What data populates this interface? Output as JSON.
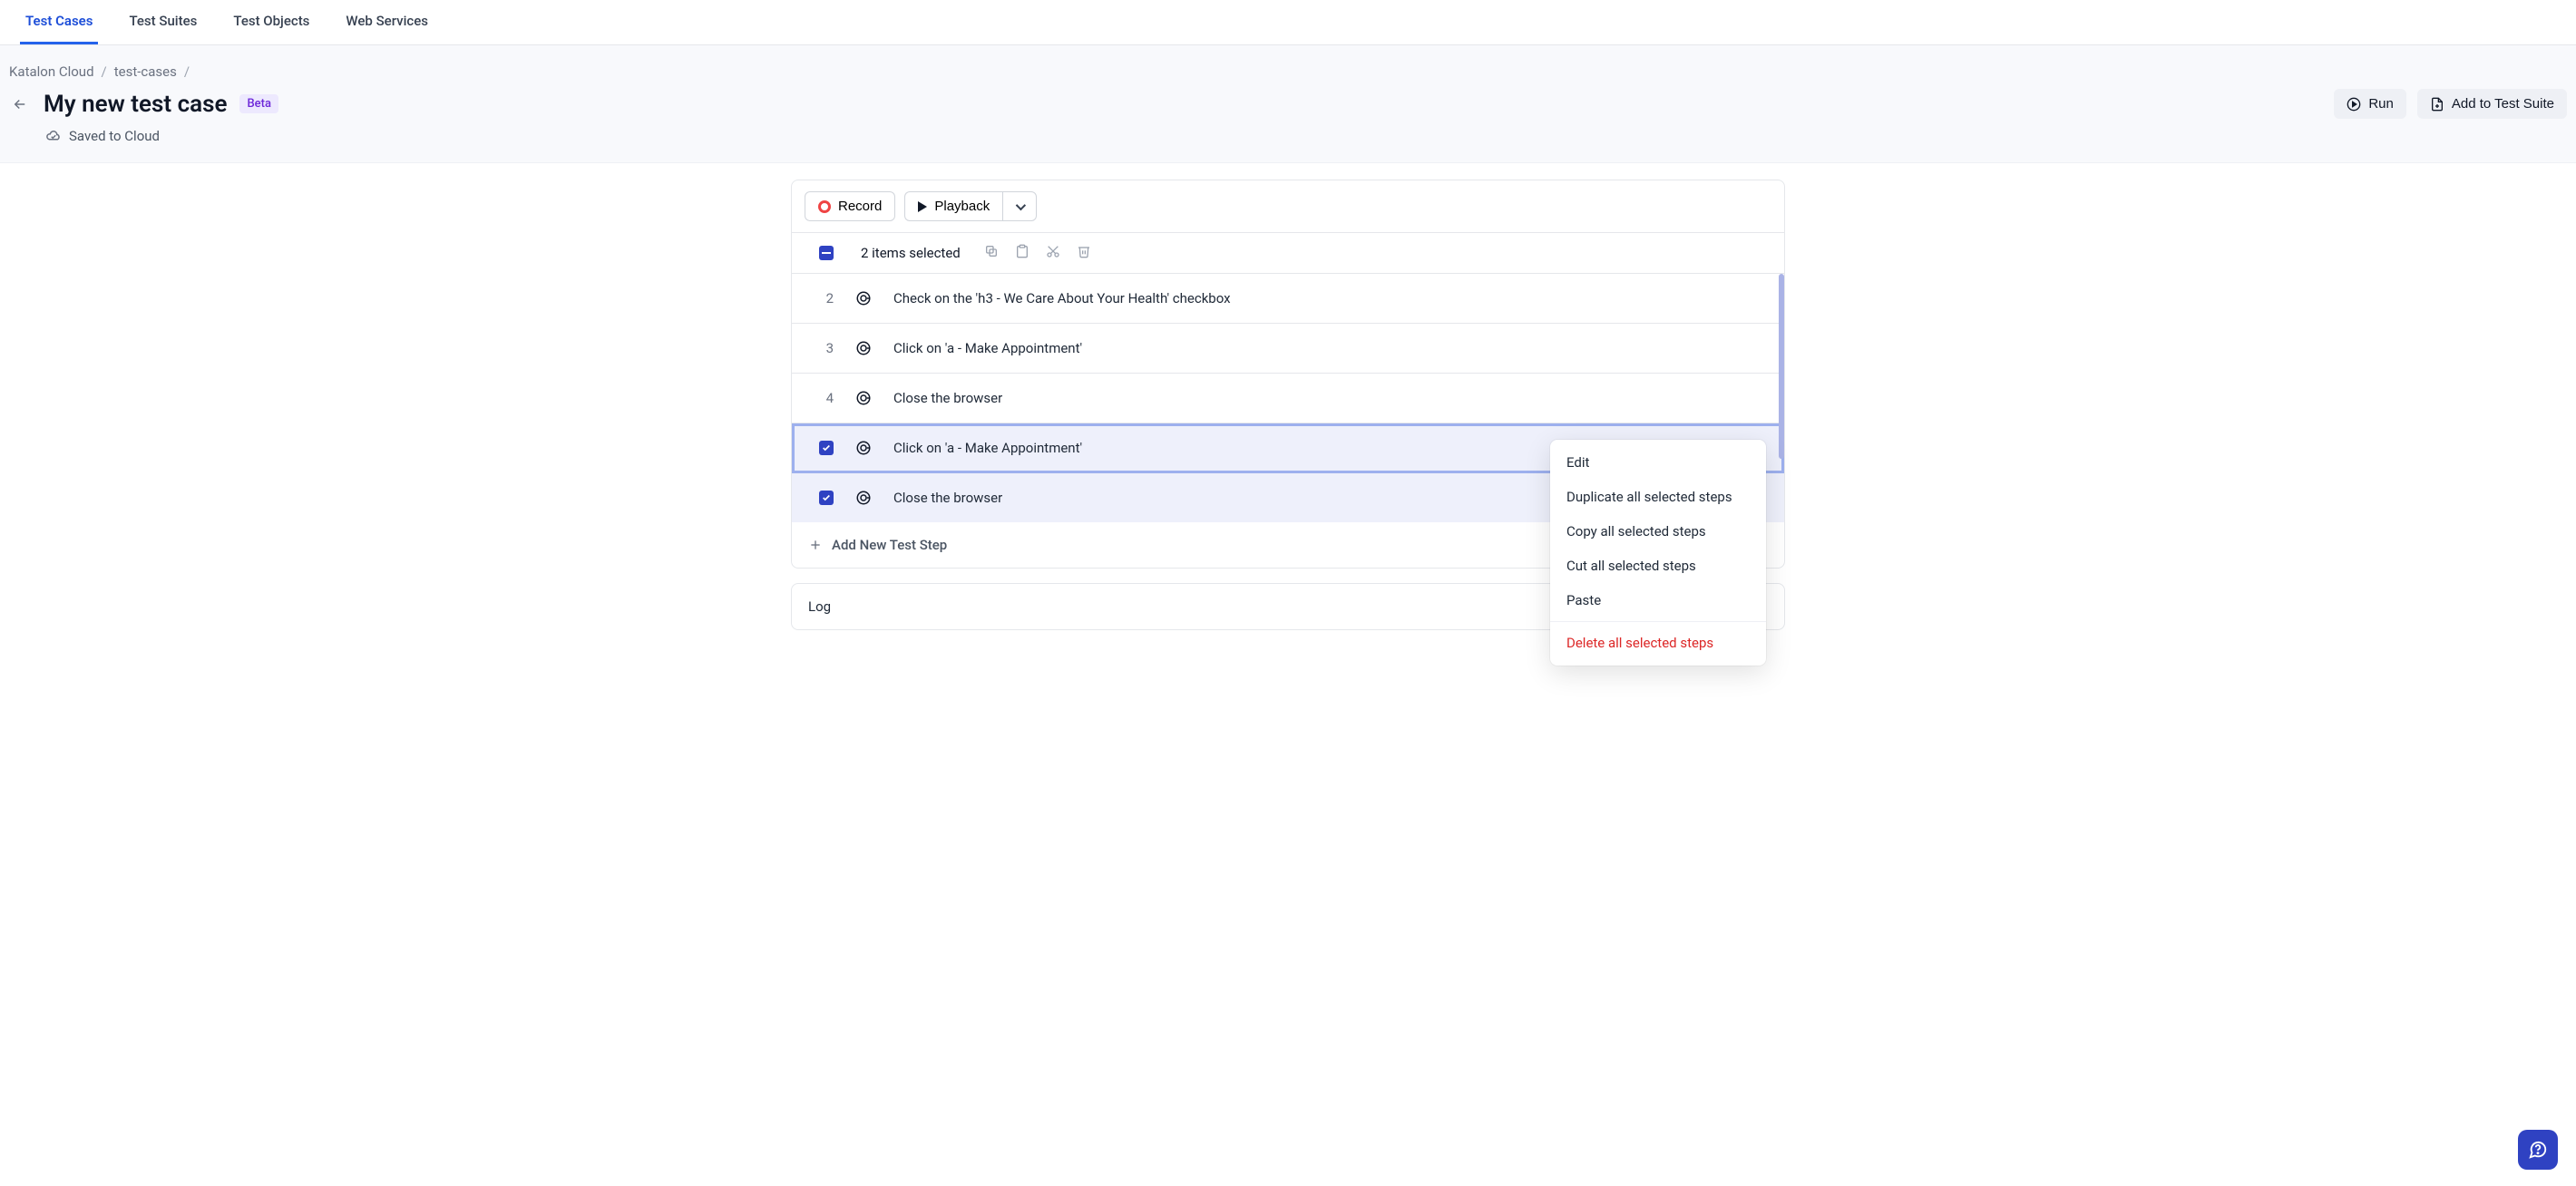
{
  "tabs": {
    "items": [
      {
        "label": "Test Cases",
        "active": true
      },
      {
        "label": "Test Suites"
      },
      {
        "label": "Test Objects"
      },
      {
        "label": "Web Services"
      }
    ]
  },
  "breadcrumb": {
    "items": [
      "Katalon Cloud",
      "test-cases"
    ]
  },
  "header": {
    "title": "My new test case",
    "badge": "Beta",
    "saved": "Saved to Cloud",
    "run": "Run",
    "add_to_suite": "Add to Test Suite"
  },
  "toolbar": {
    "record": "Record",
    "playback": "Playback"
  },
  "selection": {
    "text": "2 items selected"
  },
  "steps": [
    {
      "index": "2",
      "text": "Check on the 'h3 - We Care About Your Health' checkbox",
      "selected": false,
      "focus": false
    },
    {
      "index": "3",
      "text": "Click on 'a - Make Appointment'",
      "selected": false,
      "focus": false
    },
    {
      "index": "4",
      "text": "Close the browser",
      "selected": false,
      "focus": false
    },
    {
      "index": "",
      "text": "Click on 'a - Make Appointment'",
      "selected": true,
      "focus": true
    },
    {
      "index": "",
      "text": "Close the browser",
      "selected": true,
      "focus": false
    }
  ],
  "add_step": "Add New Test Step",
  "log_label": "Log",
  "context_menu": {
    "edit": "Edit",
    "duplicate": "Duplicate all selected steps",
    "copy": "Copy all selected steps",
    "cut": "Cut all selected steps",
    "paste": "Paste",
    "delete": "Delete all selected steps"
  }
}
